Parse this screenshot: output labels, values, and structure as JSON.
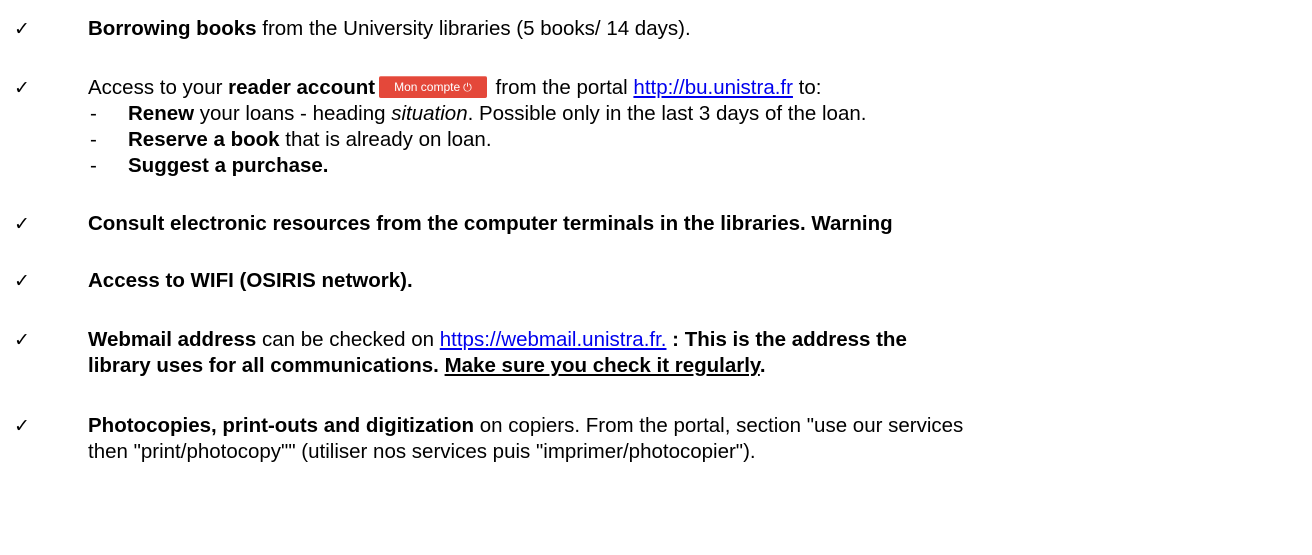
{
  "items": [
    {
      "bold": "Borrowing books",
      "rest": " from the University libraries (5 books/ 14 days)."
    },
    {
      "pre": "Access to your ",
      "bold": "reader account",
      "button_label": "Mon compte",
      "mid": " from the portal ",
      "link": "http://bu.unistra.fr",
      "post": " to:",
      "subitems": [
        {
          "dash": "-",
          "bold": "Renew",
          "rest_a": " your loans - heading ",
          "italic": "situation",
          "rest_b": ". Possible only in the last 3 days of the loan."
        },
        {
          "dash": "-",
          "bold": "Reserve a book",
          "rest": " that is already on loan."
        },
        {
          "dash": "-",
          "bold": "Suggest a purchase."
        }
      ]
    },
    {
      "bold": "Consult electronic resources from the computer terminals in the libraries. Warning"
    },
    {
      "bold": "Access to WIFI (OSIRIS network)."
    },
    {
      "bold": "Webmail address",
      "mid": " can be checked on ",
      "link": "https://webmail.unistra.fr.",
      "bold_after": " : This is the address the",
      "line2_bold": "library uses for all communications. ",
      "line2_underline": "Make sure you check it regularly",
      "line2_end": "."
    },
    {
      "bold": "Photocopies, print-outs and digitization",
      "rest": " on copiers. From the portal, section \"use our services",
      "line2": "then \"print/photocopy\"\" (utiliser nos services puis \"imprimer/photocopier\")."
    }
  ],
  "icons": {
    "check": "checkmark-icon",
    "power": "power-icon"
  },
  "colors": {
    "button_bg": "#e4483a",
    "link": "#0000ee"
  }
}
